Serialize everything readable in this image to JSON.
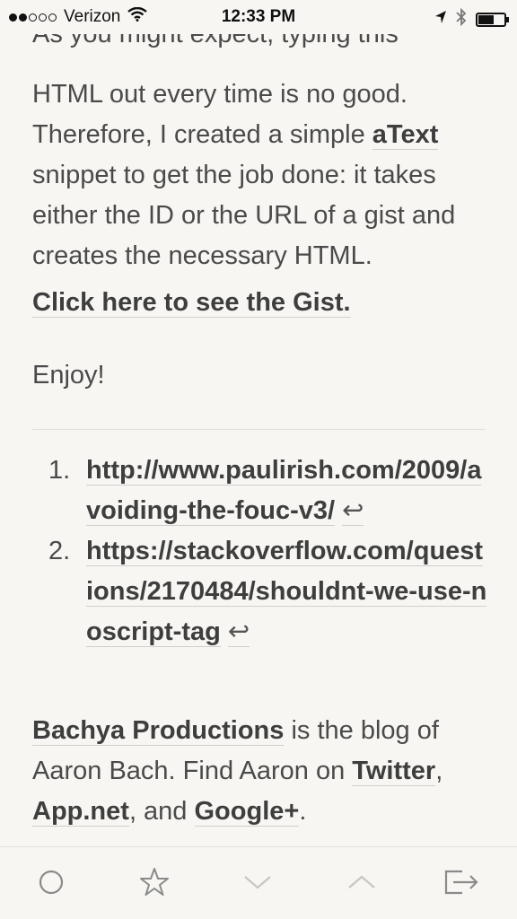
{
  "status_bar": {
    "carrier": "Verizon",
    "time": "12:33 PM",
    "signal_bars_filled": 2,
    "signal_bars_total": 5,
    "battery_level": 0.55
  },
  "article": {
    "cut_line": "As you might expect, typing this",
    "para1_before": "HTML out every time is no good. Therefore, I created a simple ",
    "atext_link": "aText",
    "para1_after": " snippet to get the job done: it takes either the ID or the URL of a gist and creates the necessary HTML.",
    "gist_link": "Click here to see the Gist.",
    "enjoy": "Enjoy!",
    "footnotes": [
      {
        "num": "1.",
        "url": "http://www.paulirish.com/2009/avoiding-the-fouc-v3/",
        "backref": "↩"
      },
      {
        "num": "2.",
        "url": "https://stackoverflow.com/questions/2170484/shouldnt-we-use-noscript-tag",
        "backref": "↩"
      }
    ],
    "bio": {
      "blog_link": "Bachya Productions",
      "text1": " is the blog of Aaron Bach. Find Aaron on ",
      "twitter": "Twitter",
      "comma": ", ",
      "appnet": "App.net",
      "and": ", and ",
      "googleplus": "Google+",
      "period": "."
    }
  },
  "toolbar": {
    "icons": [
      "circle-icon",
      "star-icon",
      "chevron-down-icon",
      "chevron-up-icon",
      "share-icon"
    ]
  },
  "colors": {
    "background": "#f7f6f3",
    "text": "#4a4a4a",
    "disabled_icon": "#c8c6c2",
    "enabled_icon": "#8a8a8a"
  }
}
